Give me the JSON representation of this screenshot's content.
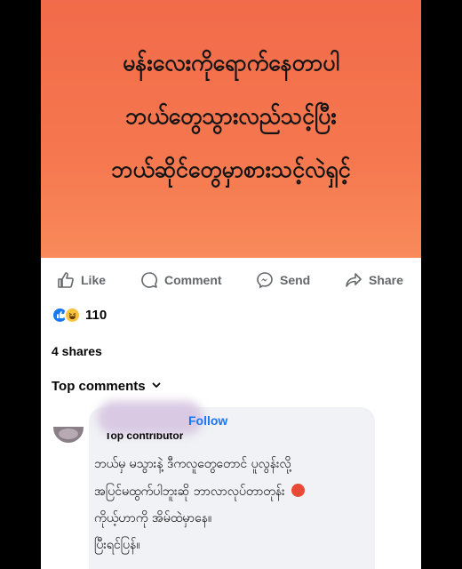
{
  "post": {
    "lines": [
      "မန်းလေးကိုရောက်နေတာပါ",
      "ဘယ်တွေသွားလည်သင့်ပြီး",
      "ဘယ်ဆိုင်တွေမှာစားသင့်လဲရှင့်"
    ],
    "background_color": "#f26b4a"
  },
  "actions": {
    "like_label": "Like",
    "comment_label": "Comment",
    "send_label": "Send",
    "share_label": "Share"
  },
  "reactions": {
    "icons": [
      "like-icon",
      "haha-icon"
    ],
    "count": "110"
  },
  "shares_text": "4 shares",
  "top_comments_label": "Top comments",
  "comment": {
    "follow_label": "Follow",
    "badge": "Top contributor",
    "lines": [
      "ဘယ်မှ မသွားနဲ့ ဒီကလူတွေတောင် ပူလွန်းလို့",
      "အပြင်မထွက်ပါဘူးဆို ဘာလာလုပ်တာတုန်း",
      "ကိုယ့်ဟာကို အိမ်ထဲမှာနေ။",
      "ပြီးရင်ပြန်။"
    ]
  },
  "colors": {
    "accent_blue": "#1877f2",
    "action_gray": "#65676b",
    "bubble_bg": "#f0f2f5"
  }
}
